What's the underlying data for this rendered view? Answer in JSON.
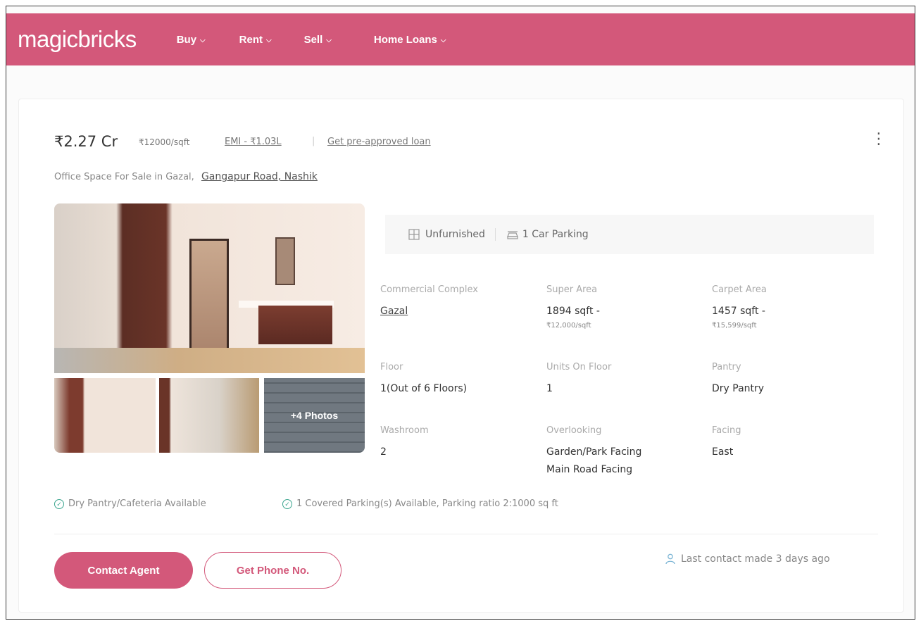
{
  "nav": {
    "logo": "magicbricks",
    "items": [
      {
        "label": "Buy"
      },
      {
        "label": "Rent"
      },
      {
        "label": "Sell"
      },
      {
        "label": "Home Loans"
      }
    ]
  },
  "listing": {
    "price": "₹2.27 Cr",
    "price_per_sqft": "₹12000/sqft",
    "emi": "EMI - ₹1.03L",
    "separator": "|",
    "preapproved": "Get pre-approved loan",
    "subtitle_prefix": "Office Space For Sale in Gazal,",
    "location": "Gangapur Road, Nashik",
    "photos_overlay": "+4 Photos",
    "amenities": [
      {
        "label": "Unfurnished",
        "icon": "furniture-icon"
      },
      {
        "label": "1 Car Parking",
        "icon": "car-icon"
      }
    ],
    "specs": {
      "complex_label": "Commercial Complex",
      "complex_value": "Gazal",
      "super_area_label": "Super Area",
      "super_area_value": "1894 sqft -",
      "super_area_rate": "₹12,000/sqft",
      "carpet_area_label": "Carpet Area",
      "carpet_area_value": "1457 sqft -",
      "carpet_area_rate": "₹15,599/sqft",
      "floor_label": "Floor",
      "floor_value": "1(Out of 6 Floors)",
      "units_label": "Units On Floor",
      "units_value": "1",
      "pantry_label": "Pantry",
      "pantry_value": "Dry Pantry",
      "washroom_label": "Washroom",
      "washroom_value": "2",
      "overlooking_label": "Overlooking",
      "overlooking_value_1": "Garden/Park Facing",
      "overlooking_value_2": "Main Road Facing",
      "facing_label": "Facing",
      "facing_value": "East"
    },
    "features": [
      "Dry Pantry/Cafeteria Available",
      "1 Covered Parking(s) Available, Parking ratio 2:1000 sq ft"
    ],
    "contact_button": "Contact Agent",
    "phone_button": "Get Phone No.",
    "last_contact": "Last contact made 3 days ago"
  },
  "colors": {
    "brand": "#d3587a",
    "check": "#3ba58e"
  }
}
